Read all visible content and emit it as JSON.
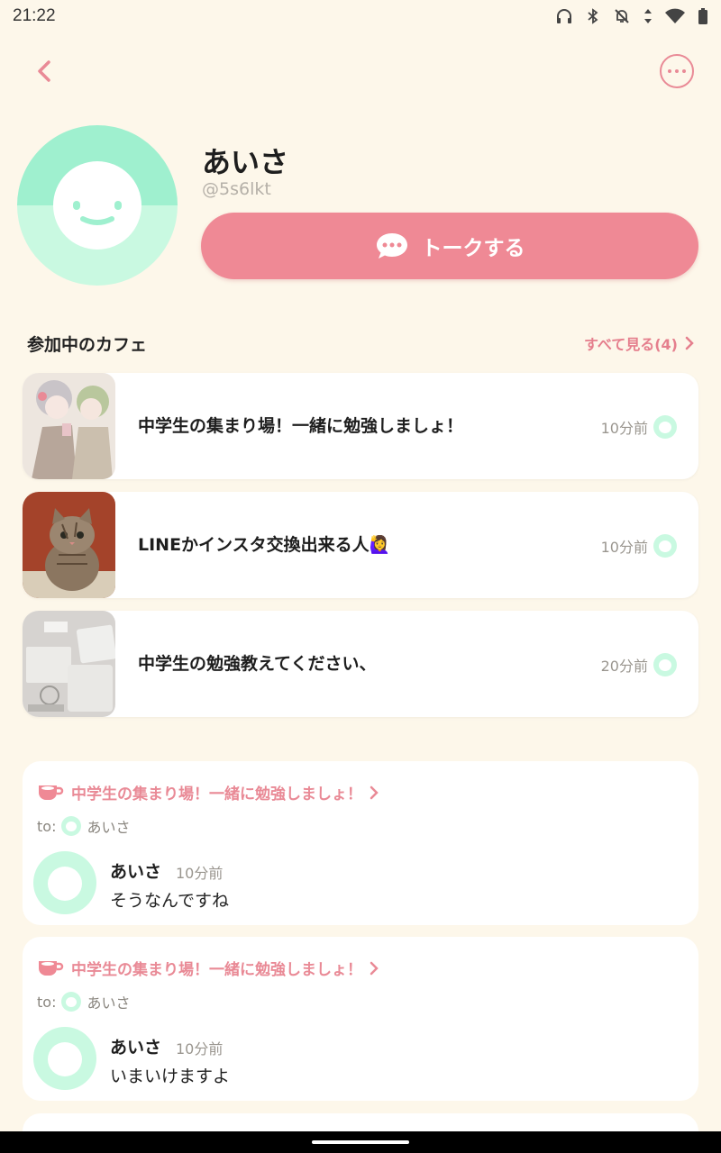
{
  "status_bar": {
    "time": "21:22",
    "icons": [
      "headphones-icon",
      "bluetooth-icon",
      "notifications-off-icon",
      "data-arrows-icon",
      "wifi-icon",
      "battery-icon"
    ]
  },
  "profile": {
    "name": "あいさ",
    "handle": "@5s6lkt",
    "talk_label": "トークする",
    "avatar_colors": {
      "top": "#9ff0cf",
      "bottom": "#c9f9e1"
    }
  },
  "cafes_section": {
    "title": "参加中のカフェ",
    "see_all": "すべて見る(4)",
    "items": [
      {
        "title": "中学生の集まり場！一緒に勉強しましょ！",
        "time": "10分前"
      },
      {
        "title": "LINEかインスタ交換出来る人🙋‍♀️",
        "time": "10分前"
      },
      {
        "title": "中学生の勉強教えてください、",
        "time": "20分前"
      }
    ]
  },
  "posts": [
    {
      "cafe": "中学生の集まり場！一緒に勉強しましょ！",
      "to_label": "to:",
      "to_name": "あいさ",
      "author": "あいさ",
      "time": "10分前",
      "message": "そうなんですね"
    },
    {
      "cafe": "中学生の集まり場！一緒に勉強しましょ！",
      "to_label": "to:",
      "to_name": "あいさ",
      "author": "あいさ",
      "time": "10分前",
      "message": "いまいけますよ"
    }
  ],
  "colors": {
    "background": "#fdf7ea",
    "accent": "#ef8995",
    "accent_text": "#e57f8d",
    "mint": "#c9f9e1"
  }
}
